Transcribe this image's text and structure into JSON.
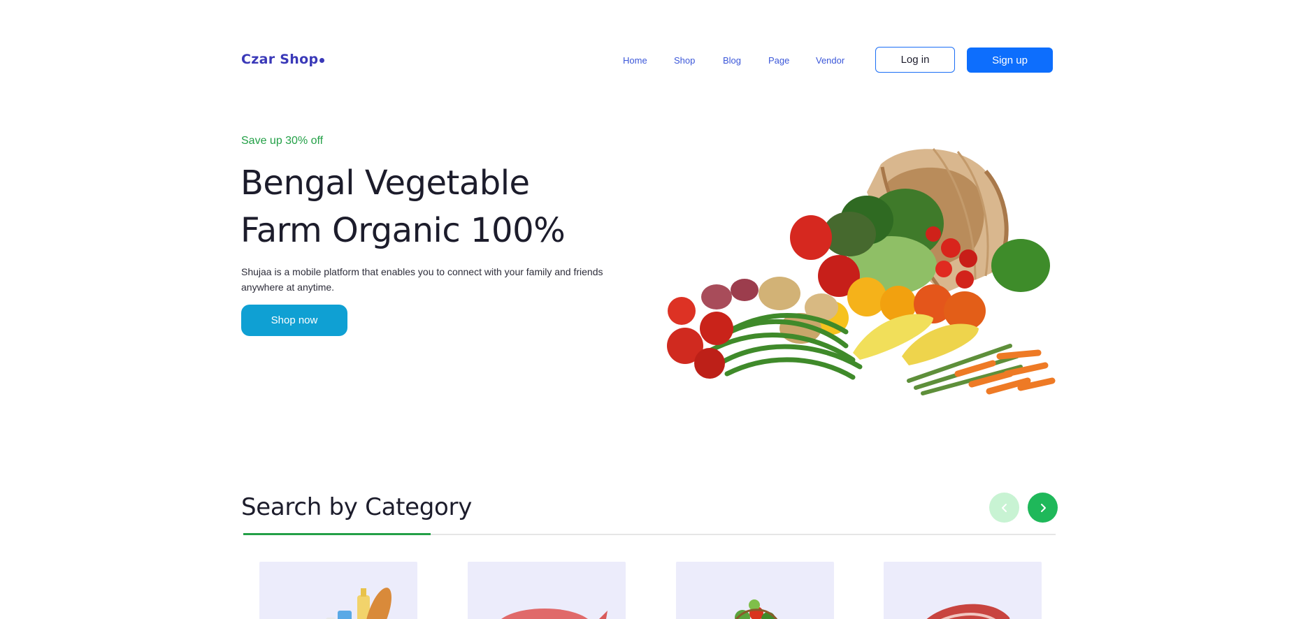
{
  "header": {
    "logo": "Czar Shop",
    "nav": [
      "Home",
      "Shop",
      "Blog",
      "Page",
      "Vendor"
    ],
    "login_label": "Log in",
    "signup_label": "Sign up"
  },
  "hero": {
    "eyebrow": "Save up 30% off",
    "title_line1": "Bengal Vegetable",
    "title_line2": "Farm Organic 100%",
    "description_line1": "Shujaa is a mobile platform that enables you to connect with your family and friends",
    "description_line2": "anywhere at anytime.",
    "cta_label": "Shop now",
    "image": "vegetable-basket-image"
  },
  "categories": {
    "title": "Search by Category",
    "prev_icon": "chevron-left-icon",
    "next_icon": "chevron-right-icon",
    "cards": [
      {
        "image": "grocery-image"
      },
      {
        "image": "fish-image"
      },
      {
        "image": "fruit-basket-image"
      },
      {
        "image": "meat-image"
      }
    ]
  },
  "colors": {
    "brand": "#3a39b8",
    "primary": "#0d6efd",
    "accent_green": "#23a047",
    "cta_blue": "#0fa0d3",
    "card_bg": "#ececfb"
  }
}
